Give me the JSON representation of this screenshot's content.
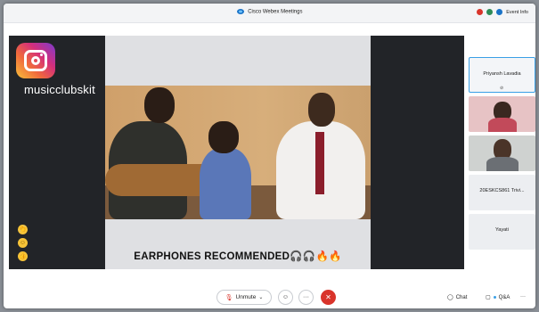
{
  "window": {
    "title": "Cisco Webex Meetings",
    "event_info": "Event Info"
  },
  "stage": {
    "brand_handle": "musicclubskit",
    "caption": "EARPHONES RECOMMENDED",
    "caption_emoji": "🎧🎧🔥🔥"
  },
  "reactions": [
    {
      "icon": "clap-icon",
      "glyph": "👏"
    },
    {
      "icon": "smile-icon",
      "glyph": "☺"
    },
    {
      "icon": "thumbs-up-icon",
      "glyph": "👍"
    }
  ],
  "participants": [
    {
      "name": "Priyansh Lavadia",
      "mic": "⊘"
    },
    {
      "name": "",
      "type": "video"
    },
    {
      "name": "",
      "type": "video"
    },
    {
      "name": "20ESKCS861 Trivi..."
    },
    {
      "name": "Yayati"
    }
  ],
  "controls": {
    "unmute_label": "Unmute",
    "chat_label": "Chat",
    "qa_label": "Q&A",
    "more_label": "···",
    "chevron": "⌄"
  },
  "colors": {
    "end_call": "#d9342b",
    "active_border": "#3aa0e6"
  }
}
